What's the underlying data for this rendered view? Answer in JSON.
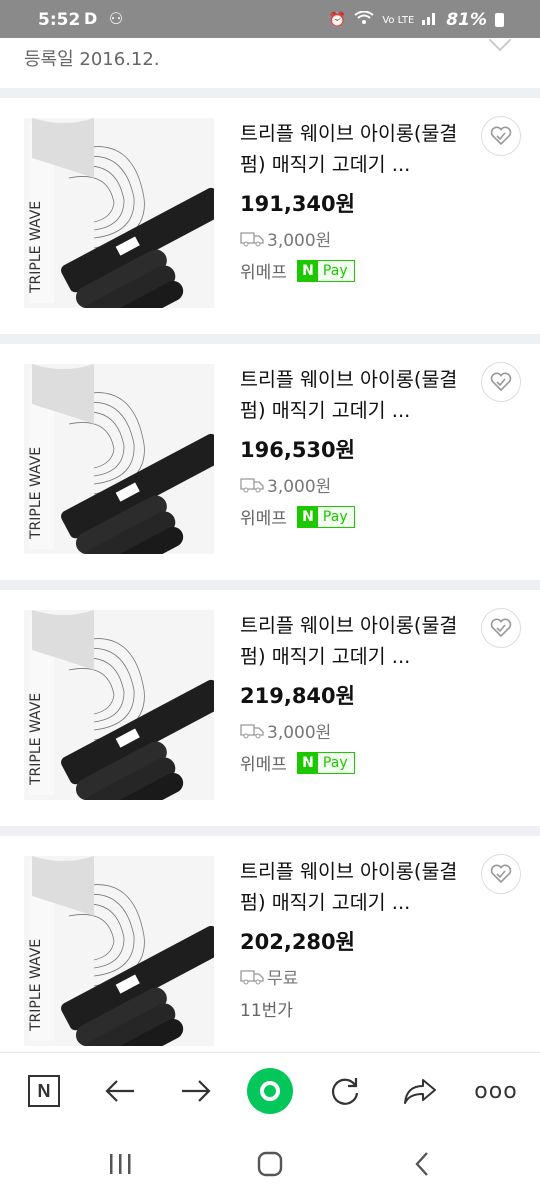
{
  "status_bar": {
    "time": "5:52",
    "left_icons": "D ⚇",
    "network": "Vo LTE",
    "battery": "81%"
  },
  "header": {
    "registered": "등록일 2016.12."
  },
  "products": [
    {
      "title": "트리플 웨이브 아이롱(물결펌) 매직기 고데기 ...",
      "price": "191,340원",
      "shipping": "3,000원",
      "store": "위메프",
      "npay": true
    },
    {
      "title": "트리플 웨이브 아이롱(물결펌) 매직기 고데기 ...",
      "price": "196,530원",
      "shipping": "3,000원",
      "store": "위메프",
      "npay": true
    },
    {
      "title": "트리플 웨이브 아이롱(물결펌) 매직기 고데기 ...",
      "price": "219,840원",
      "shipping": "3,000원",
      "store": "위메프",
      "npay": true
    },
    {
      "title": "트리플 웨이브 아이롱(물결펌) 매직기 고데기 ...",
      "price": "202,280원",
      "shipping": "무료",
      "store": "11번가",
      "npay": false
    }
  ],
  "npay_badge": {
    "n": "N",
    "label": "Pay"
  },
  "browser_bar": {
    "home_logo": "N",
    "more": "ooo"
  }
}
